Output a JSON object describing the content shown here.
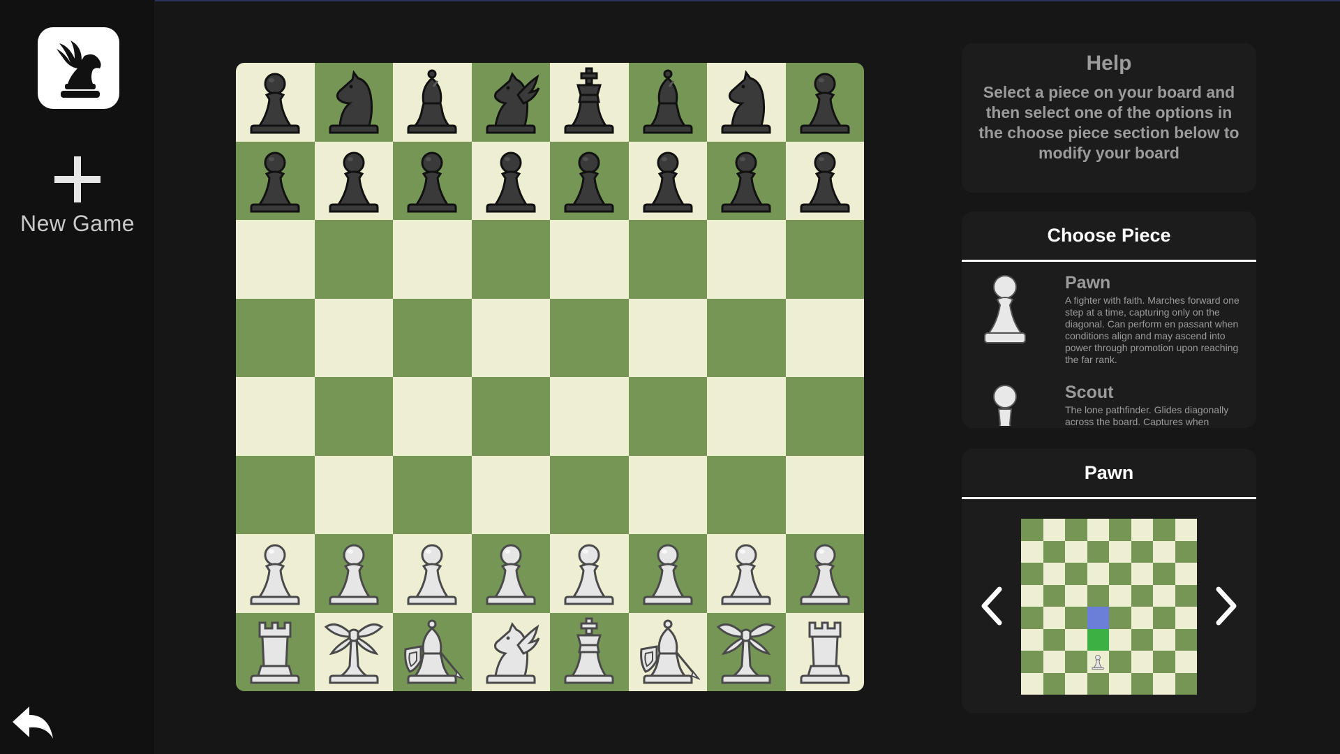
{
  "sidebar": {
    "logo_icon": "black-pegasus-knight-icon",
    "new_game_label": "New Game",
    "back_icon": "undo-arrow-icon"
  },
  "colors": {
    "background": "#161616",
    "sidebar": "#111111",
    "panel": "#1c1c1c",
    "light_square": "#eeeed2",
    "dark_square": "#769656",
    "move_square": "#3cb043",
    "attack_square": "#6c7fd8",
    "panel_text": "#9b9b9b"
  },
  "board": {
    "rows": [
      [
        "black-pawn-icon",
        "black-knight-icon",
        "black-bishop-icon",
        "black-pegasus-icon",
        "black-king-icon",
        "black-bishop-icon",
        "black-knight-icon",
        "black-pawn-icon"
      ],
      [
        "black-pawn-icon",
        "black-pawn-icon",
        "black-pawn-icon",
        "black-pawn-icon",
        "black-pawn-icon",
        "black-pawn-icon",
        "black-pawn-icon",
        "black-pawn-icon"
      ],
      [
        "",
        "",
        "",
        "",
        "",
        "",
        "",
        ""
      ],
      [
        "",
        "",
        "",
        "",
        "",
        "",
        "",
        ""
      ],
      [
        "",
        "",
        "",
        "",
        "",
        "",
        "",
        ""
      ],
      [
        "",
        "",
        "",
        "",
        "",
        "",
        "",
        ""
      ],
      [
        "white-pawn-icon",
        "white-pawn-icon",
        "white-pawn-icon",
        "white-pawn-icon",
        "white-pawn-icon",
        "white-pawn-icon",
        "white-pawn-icon",
        "white-pawn-icon"
      ],
      [
        "white-rook-icon",
        "white-dragonfly-icon",
        "white-paladin-icon",
        "white-pegasus-icon",
        "white-king-icon",
        "white-paladin-icon",
        "white-dragonfly-icon",
        "white-rook-icon"
      ]
    ]
  },
  "help": {
    "title": "Help",
    "text": "Select a piece on your board and then select one of the options in the choose piece section below to modify your board"
  },
  "choose_piece": {
    "title": "Choose Piece",
    "items": [
      {
        "name": "Pawn",
        "icon": "white-pawn-icon",
        "description": "A fighter with faith. Marches forward one step at a time, capturing only on the diagonal. Can perform en passant when conditions align and may ascend into power through promotion upon reaching the far rank."
      },
      {
        "name": "Scout",
        "icon": "white-scout-icon",
        "description": "The lone pathfinder. Glides diagonally across the board. Captures when retreating backward and removes the"
      }
    ]
  },
  "preview": {
    "title": "Pawn",
    "prev_icon": "chevron-left-icon",
    "next_icon": "chevron-right-icon",
    "piece_icon": "white-pawn-icon",
    "piece_square": "d2",
    "move_square": "d3",
    "attack_square": "d4"
  }
}
